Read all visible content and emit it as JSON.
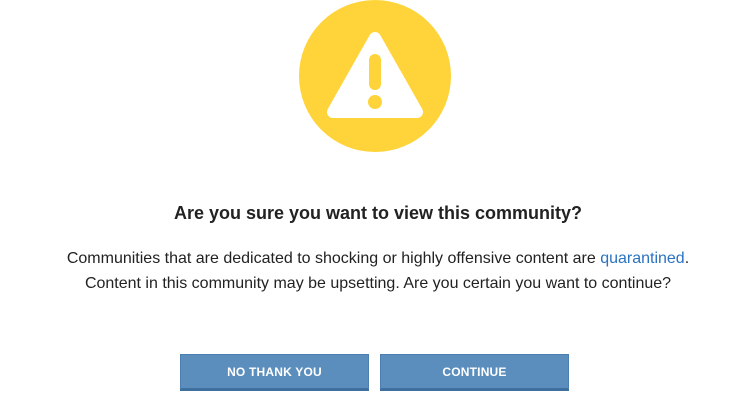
{
  "icon": {
    "name": "warning-icon",
    "circle_color": "#ffd43a",
    "glyph_color": "#ffffff"
  },
  "dialog": {
    "title": "Are you sure you want to view this community?",
    "message_before_link": "Communities that are dedicated to shocking or highly offensive content are ",
    "link_text": "quarantined",
    "message_after_link": ". Content in this community may be upsetting. Are you certain you want to continue?",
    "link_color": "#2a73c2"
  },
  "buttons": {
    "decline_label": "NO THANK YOU",
    "confirm_label": "CONTINUE",
    "button_color": "#5b8ebd"
  }
}
